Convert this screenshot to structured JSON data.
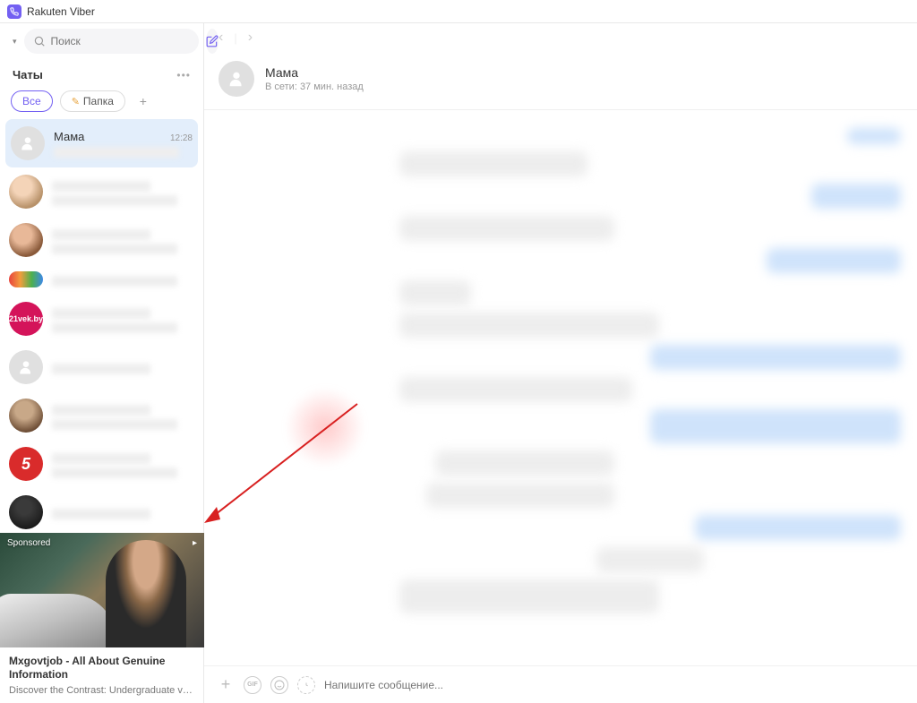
{
  "titlebar": {
    "app_name": "Rakuten Viber"
  },
  "sidebar": {
    "search_placeholder": "Поиск",
    "chats_label": "Чаты",
    "filters": {
      "all": "Все",
      "folder": "Папка"
    },
    "active_chat": {
      "name": "Мама",
      "time": "12:28"
    },
    "avatar_21_text": "21vek.by",
    "avatar_5_text": "5"
  },
  "sponsored": {
    "label": "Sponsored",
    "title": "Mxgovtjob - All About Genuine Information",
    "desc": "Discover the Contrast: Undergraduate vs ..."
  },
  "header": {
    "name": "Мама",
    "status": "В сети: 37 мин. назад"
  },
  "composer": {
    "placeholder": "Напишите сообщение...",
    "gif_label": "GIF"
  }
}
